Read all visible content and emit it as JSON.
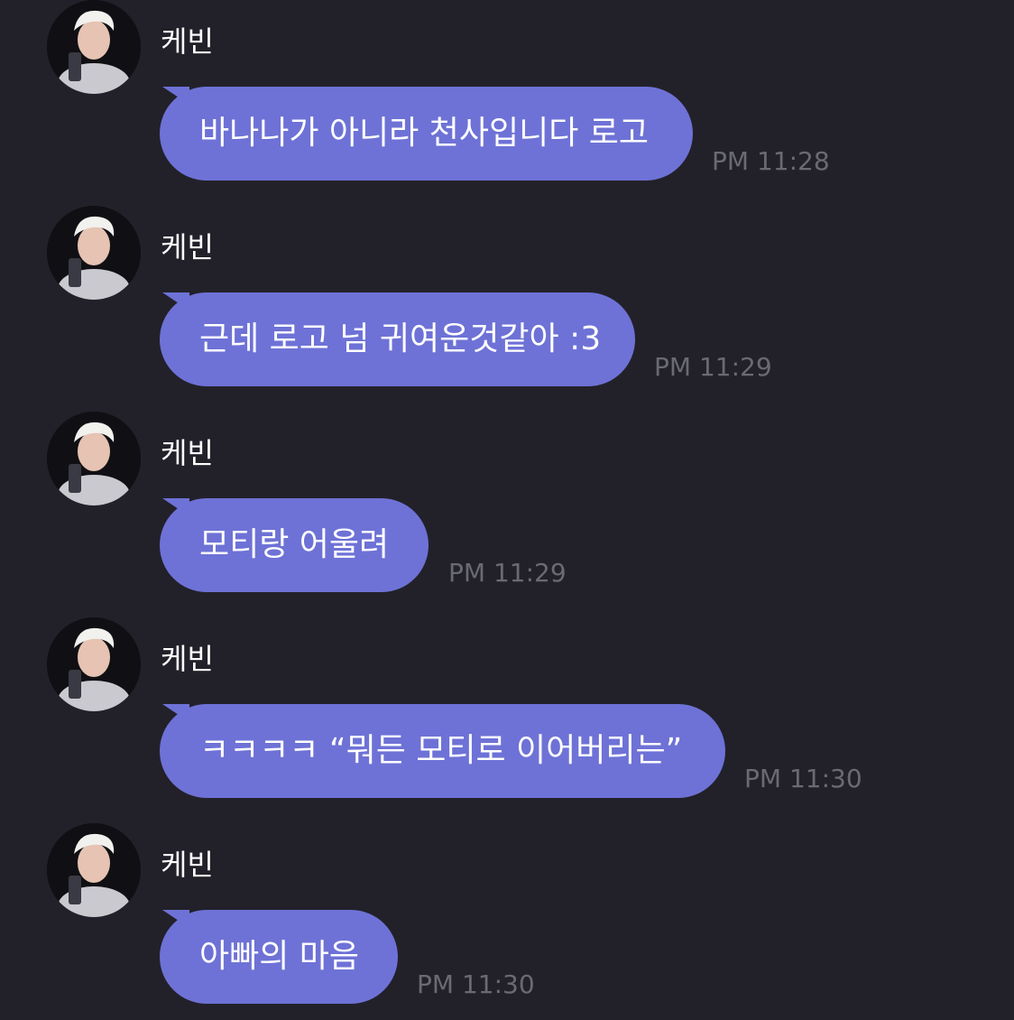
{
  "messages": [
    {
      "sender": "케빈",
      "text": "바나나가 아니라 천사입니다 로고",
      "time": "PM 11:28"
    },
    {
      "sender": "케빈",
      "text": "근데 로고 넘 귀여운것같아 :3",
      "time": "PM 11:29"
    },
    {
      "sender": "케빈",
      "text": "모티랑 어울려",
      "time": "PM 11:29"
    },
    {
      "sender": "케빈",
      "text": "ㅋㅋㅋㅋ “뭐든 모티로 이어버리는”",
      "time": "PM 11:30"
    },
    {
      "sender": "케빈",
      "text": "아빠의 마음",
      "time": "PM 11:30"
    }
  ],
  "colors": {
    "background": "#22212a",
    "bubble": "#6e72d6",
    "timestamp": "#6a6a74"
  },
  "icons": {
    "avatar": "profile-photo"
  }
}
